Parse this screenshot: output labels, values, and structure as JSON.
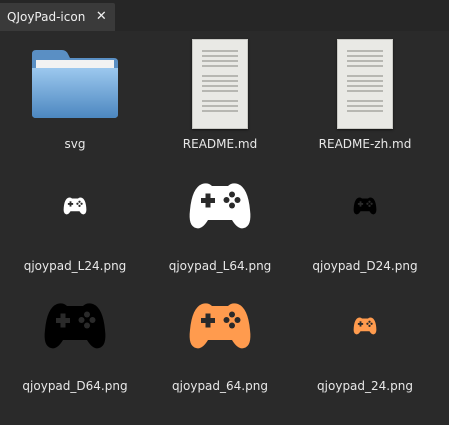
{
  "tab": {
    "title": "QJoyPad-icon",
    "close_glyph": "✕"
  },
  "files": [
    {
      "name": "svg",
      "icon": "folder-icon"
    },
    {
      "name": "README.md",
      "icon": "text-document-icon"
    },
    {
      "name": "README-zh.md",
      "icon": "text-document-icon"
    },
    {
      "name": "qjoypad_L24.png",
      "icon": "gamepad-icon",
      "color": "#ffffff"
    },
    {
      "name": "qjoypad_L64.png",
      "icon": "gamepad-icon",
      "color": "#ffffff"
    },
    {
      "name": "qjoypad_D24.png",
      "icon": "gamepad-icon",
      "color": "#000000"
    },
    {
      "name": "qjoypad_D64.png",
      "icon": "gamepad-icon",
      "color": "#000000"
    },
    {
      "name": "qjoypad_64.png",
      "icon": "gamepad-icon",
      "color": "#ff9b4e"
    },
    {
      "name": "qjoypad_24.png",
      "icon": "gamepad-icon",
      "color": "#ff9b4e"
    }
  ],
  "colors": {
    "background": "#2a2a2a",
    "tab": "#3a3a3a",
    "folder": "#6ea6d6"
  }
}
